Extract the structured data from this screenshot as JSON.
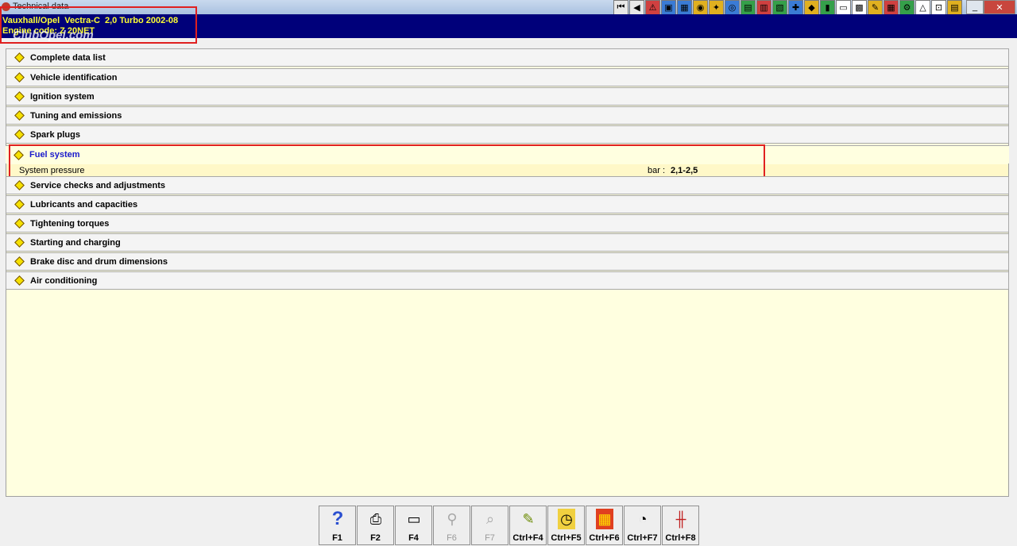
{
  "window": {
    "title": "Technical data",
    "minimize": "_",
    "maximize": "□",
    "close": "✕"
  },
  "header": {
    "vehicle": "Vauxhall/Opel  Vectra-C  2,0 Turbo 2002-08",
    "engine": "Engine code: Z 20NET",
    "watermark": "ClubOpel.com"
  },
  "toolbar": [
    {
      "icon": "first-record-icon",
      "glyph": "⏮"
    },
    {
      "icon": "previous-record-icon",
      "glyph": "◀"
    },
    {
      "icon": "warning-icon",
      "glyph": "⚠"
    },
    {
      "icon": "engine-data-icon",
      "glyph": "▣"
    },
    {
      "icon": "diagram-icon",
      "glyph": "▦"
    },
    {
      "icon": "fuel-icon",
      "glyph": "◉"
    },
    {
      "icon": "tools-icon",
      "glyph": "✦"
    },
    {
      "icon": "tyre-icon",
      "glyph": "◎"
    },
    {
      "icon": "wiring-icon",
      "glyph": "▤"
    },
    {
      "icon": "repair-times-icon",
      "glyph": "▥"
    },
    {
      "icon": "lift-icon",
      "glyph": "▧"
    },
    {
      "icon": "service-icon",
      "glyph": "✚"
    },
    {
      "icon": "parts-icon",
      "glyph": "◆"
    },
    {
      "icon": "battery-icon",
      "glyph": "▮"
    },
    {
      "icon": "window-icon",
      "glyph": "▭"
    },
    {
      "icon": "manual-icon",
      "glyph": "▩"
    },
    {
      "icon": "key-icon",
      "glyph": "✎"
    },
    {
      "icon": "fuse-icon",
      "glyph": "▦"
    },
    {
      "icon": "gear-icon",
      "glyph": "⚙"
    },
    {
      "icon": "warning-light-icon",
      "glyph": "△"
    },
    {
      "icon": "car-icon",
      "glyph": "⊡"
    },
    {
      "icon": "settings-icon",
      "glyph": "▤"
    }
  ],
  "sections": [
    {
      "label": "Complete data list"
    },
    {
      "label": "Vehicle identification"
    },
    {
      "label": "Ignition system"
    },
    {
      "label": "Tuning and emissions"
    },
    {
      "label": "Spark plugs"
    },
    {
      "label": "Fuel system"
    },
    {
      "label": "Service checks and adjustments"
    },
    {
      "label": "Lubricants and capacities"
    },
    {
      "label": "Tightening torques"
    },
    {
      "label": "Starting and charging"
    },
    {
      "label": "Brake disc and drum dimensions"
    },
    {
      "label": "Air conditioning"
    }
  ],
  "fuel_system": {
    "label": "System pressure",
    "unit": "bar :",
    "value": "2,1-2,5"
  },
  "function_keys": [
    {
      "label": "F1",
      "icon": "help-icon",
      "glyph": "?"
    },
    {
      "label": "F2",
      "icon": "printer-icon",
      "glyph": "⎙"
    },
    {
      "label": "F4",
      "icon": "monitor-icon",
      "glyph": "▭"
    },
    {
      "label": "F6",
      "icon": "magnifier-icon",
      "glyph": "⚲"
    },
    {
      "label": "F7",
      "icon": "search-icon",
      "glyph": "⌕"
    },
    {
      "label": "Ctrl+F4",
      "icon": "notes-icon",
      "glyph": "✎"
    },
    {
      "label": "Ctrl+F5",
      "icon": "timer-icon",
      "glyph": "◷"
    },
    {
      "label": "Ctrl+F6",
      "icon": "calendar-icon",
      "glyph": "▦"
    },
    {
      "label": "Ctrl+F7",
      "icon": "dashboard-icon",
      "glyph": "◔"
    },
    {
      "label": "Ctrl+F8",
      "icon": "lift-icon",
      "glyph": "╫"
    }
  ]
}
